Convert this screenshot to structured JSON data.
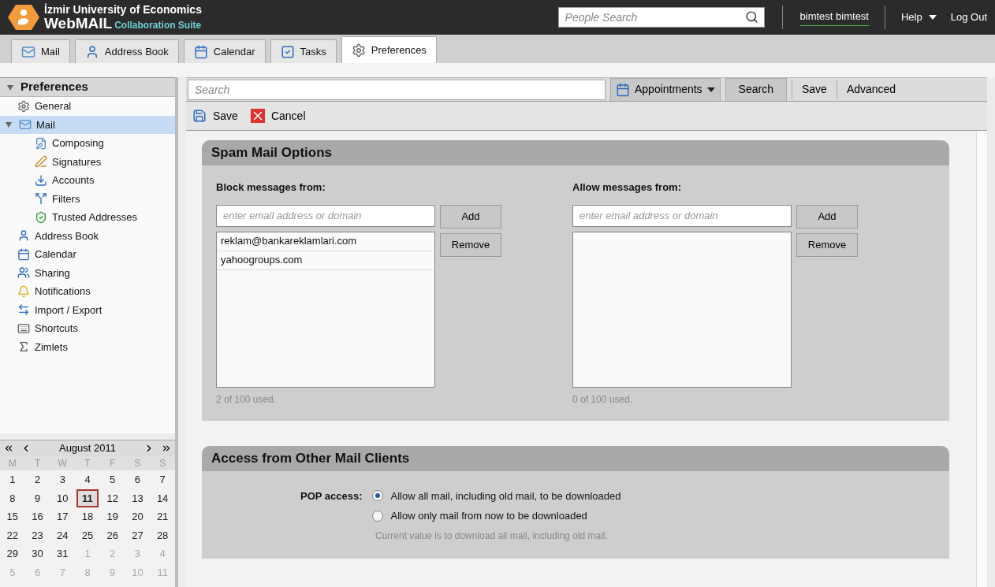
{
  "header": {
    "org": "İzmir University of Economics",
    "product": "WebMAIL",
    "suite": "Collaboration Suite",
    "people_search": {
      "placeholder": "People Search"
    },
    "user": "bimtest bimtest",
    "help": "Help",
    "logout": "Log Out"
  },
  "tabs": [
    {
      "label": "Mail",
      "selected": false
    },
    {
      "label": "Address Book",
      "selected": false
    },
    {
      "label": "Calendar",
      "selected": false
    },
    {
      "label": "Tasks",
      "selected": false
    },
    {
      "label": "Preferences",
      "selected": true
    }
  ],
  "sidebar": {
    "title": "Preferences",
    "expanded": true,
    "items": [
      {
        "label": "General",
        "selected": false
      },
      {
        "label": "Mail",
        "selected": true,
        "expanded": true,
        "children": [
          {
            "label": "Composing",
            "selected": false
          },
          {
            "label": "Signatures",
            "selected": false
          },
          {
            "label": "Accounts",
            "selected": false
          },
          {
            "label": "Filters",
            "selected": false
          },
          {
            "label": "Trusted Addresses",
            "selected": false
          }
        ]
      },
      {
        "label": "Address Book",
        "selected": false
      },
      {
        "label": "Calendar",
        "selected": false
      },
      {
        "label": "Sharing",
        "selected": false
      },
      {
        "label": "Notifications",
        "selected": false
      },
      {
        "label": "Import / Export",
        "selected": false
      },
      {
        "label": "Shortcuts",
        "selected": false
      },
      {
        "label": "Zimlets",
        "selected": false
      }
    ]
  },
  "mini_calendar": {
    "month": "August 2011",
    "weekdays": [
      "M",
      "T",
      "W",
      "T",
      "F",
      "S",
      "S"
    ],
    "weeks": [
      [
        {
          "day": "1",
          "other_month": false,
          "today": false
        },
        {
          "day": "2",
          "other_month": false,
          "today": false
        },
        {
          "day": "3",
          "other_month": false,
          "today": false
        },
        {
          "day": "4",
          "other_month": false,
          "today": false
        },
        {
          "day": "5",
          "other_month": false,
          "today": false
        },
        {
          "day": "6",
          "other_month": false,
          "today": false
        },
        {
          "day": "7",
          "other_month": false,
          "today": false
        }
      ],
      [
        {
          "day": "8",
          "other_month": false,
          "today": false
        },
        {
          "day": "9",
          "other_month": false,
          "today": false
        },
        {
          "day": "10",
          "other_month": false,
          "today": false
        },
        {
          "day": "11",
          "other_month": false,
          "today": true
        },
        {
          "day": "12",
          "other_month": false,
          "today": false
        },
        {
          "day": "13",
          "other_month": false,
          "today": false
        },
        {
          "day": "14",
          "other_month": false,
          "today": false
        }
      ],
      [
        {
          "day": "15",
          "other_month": false,
          "today": false
        },
        {
          "day": "16",
          "other_month": false,
          "today": false
        },
        {
          "day": "17",
          "other_month": false,
          "today": false
        },
        {
          "day": "18",
          "other_month": false,
          "today": false
        },
        {
          "day": "19",
          "other_month": false,
          "today": false
        },
        {
          "day": "20",
          "other_month": false,
          "today": false
        },
        {
          "day": "21",
          "other_month": false,
          "today": false
        }
      ],
      [
        {
          "day": "22",
          "other_month": false,
          "today": false
        },
        {
          "day": "23",
          "other_month": false,
          "today": false
        },
        {
          "day": "24",
          "other_month": false,
          "today": false
        },
        {
          "day": "25",
          "other_month": false,
          "today": false
        },
        {
          "day": "26",
          "other_month": false,
          "today": false
        },
        {
          "day": "27",
          "other_month": false,
          "today": false
        },
        {
          "day": "28",
          "other_month": false,
          "today": false
        }
      ],
      [
        {
          "day": "29",
          "other_month": false,
          "today": false
        },
        {
          "day": "30",
          "other_month": false,
          "today": false
        },
        {
          "day": "31",
          "other_month": false,
          "today": false
        },
        {
          "day": "1",
          "other_month": true,
          "today": false
        },
        {
          "day": "2",
          "other_month": true,
          "today": false
        },
        {
          "day": "3",
          "other_month": true,
          "today": false
        },
        {
          "day": "4",
          "other_month": true,
          "today": false
        }
      ],
      [
        {
          "day": "5",
          "other_month": true,
          "today": false
        },
        {
          "day": "6",
          "other_month": true,
          "today": false
        },
        {
          "day": "7",
          "other_month": true,
          "today": false
        },
        {
          "day": "8",
          "other_month": true,
          "today": false
        },
        {
          "day": "9",
          "other_month": true,
          "today": false
        },
        {
          "day": "10",
          "other_month": true,
          "today": false
        },
        {
          "day": "11",
          "other_month": true,
          "today": false
        }
      ]
    ]
  },
  "search_bar": {
    "placeholder": "Search",
    "type_menu": "Appointments",
    "search": "Search",
    "save": "Save",
    "advanced": "Advanced"
  },
  "toolbar": {
    "save": "Save",
    "cancel": "Cancel"
  },
  "spam_options": {
    "title": "Spam Mail Options",
    "lists": [
      {
        "label": "Block messages from:",
        "placeholder": "enter email address or domain",
        "add": "Add",
        "remove": "Remove",
        "entries": [
          "reklam@bankareklamlari.com",
          "yahoogroups.com"
        ],
        "usage": "2 of 100 used."
      },
      {
        "label": "Allow messages from:",
        "placeholder": "enter email address or domain",
        "add": "Add",
        "remove": "Remove",
        "usage": "0 of 100 used."
      }
    ]
  },
  "access_options": {
    "title": "Access from Other Mail Clients",
    "label": "POP access:",
    "options": [
      {
        "label": "Allow all mail, including old mail, to be downloaded",
        "selected": true
      },
      {
        "label": "Allow only mail from now to be downloaded",
        "selected": false
      }
    ],
    "note": "Current value is to download all mail, including old mail."
  }
}
